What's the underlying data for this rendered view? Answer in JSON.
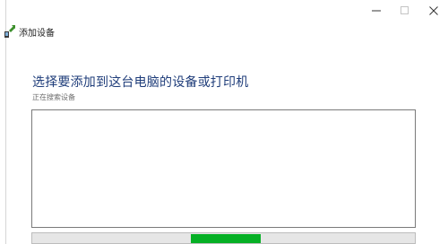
{
  "window": {
    "title": "添加设备",
    "controls": {
      "minimize_icon": "minimize-icon",
      "maximize_icon": "maximize-icon",
      "close_icon": "close-icon"
    }
  },
  "main": {
    "heading": "选择要添加到这台电脑的设备或打印机",
    "status": "正在搜索设备"
  },
  "progress": {
    "style": "indeterminate-marquee",
    "color": "#06b025"
  },
  "colors": {
    "heading": "#1f3d7a",
    "progress_fill": "#06b025",
    "list_border": "#7a7a7a"
  }
}
